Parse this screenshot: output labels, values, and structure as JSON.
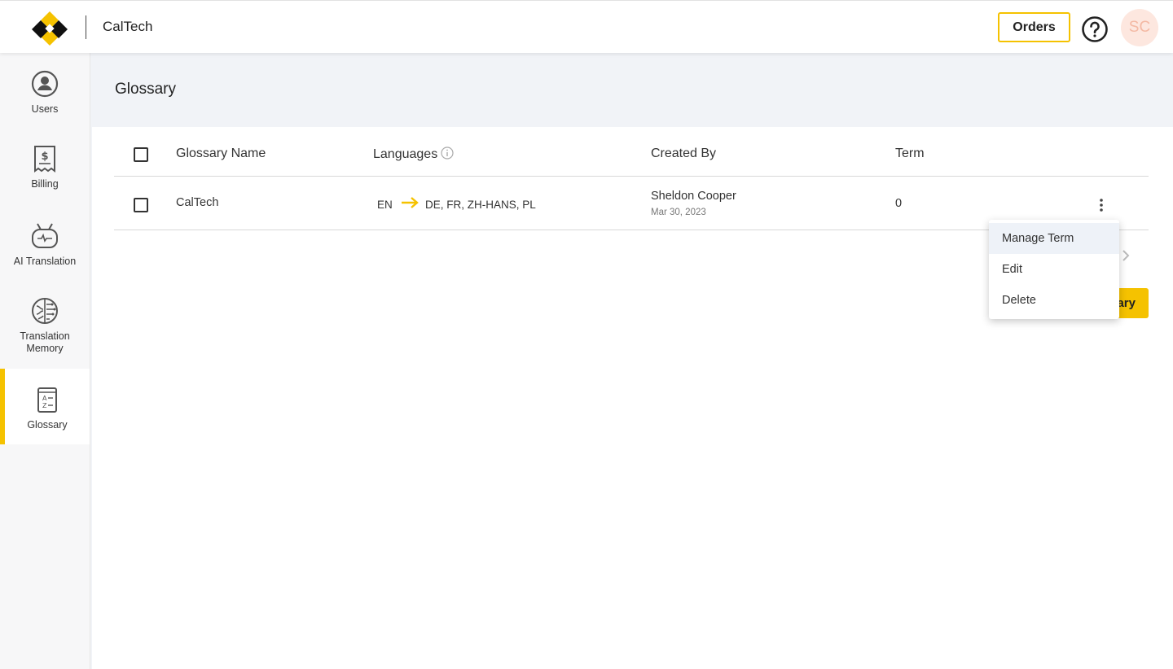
{
  "header": {
    "brand": "CalTech",
    "orders_label": "Orders",
    "avatar_initials": "SC",
    "accent_color": "#f5c200",
    "icons": [
      "logo-icon",
      "help-icon"
    ]
  },
  "sidebar": {
    "items": [
      {
        "label": "Users",
        "icon": "user-circle-icon"
      },
      {
        "label": "Billing",
        "icon": "receipt-dollar-icon"
      },
      {
        "label": "AI Translation",
        "icon": "robot-icon"
      },
      {
        "label": "Translation Memory",
        "icon": "brain-icon"
      },
      {
        "label": "Glossary",
        "icon": "glossary-book-icon",
        "active": true
      }
    ]
  },
  "page": {
    "title": "Glossary"
  },
  "table": {
    "columns": [
      "Glossary Name",
      "Languages",
      "Created By",
      "Term"
    ],
    "rows": [
      {
        "name": "CalTech",
        "source_lang": "EN",
        "target_langs": "DE, FR, ZH-HANS, PL",
        "created_by": "Sheldon Cooper",
        "created_date": "Mar 30, 2023",
        "term": "0"
      }
    ]
  },
  "new_button_partial_label": "ary",
  "context_menu": {
    "items": [
      "Manage Term",
      "Edit",
      "Delete"
    ],
    "hovered": "Manage Term"
  }
}
